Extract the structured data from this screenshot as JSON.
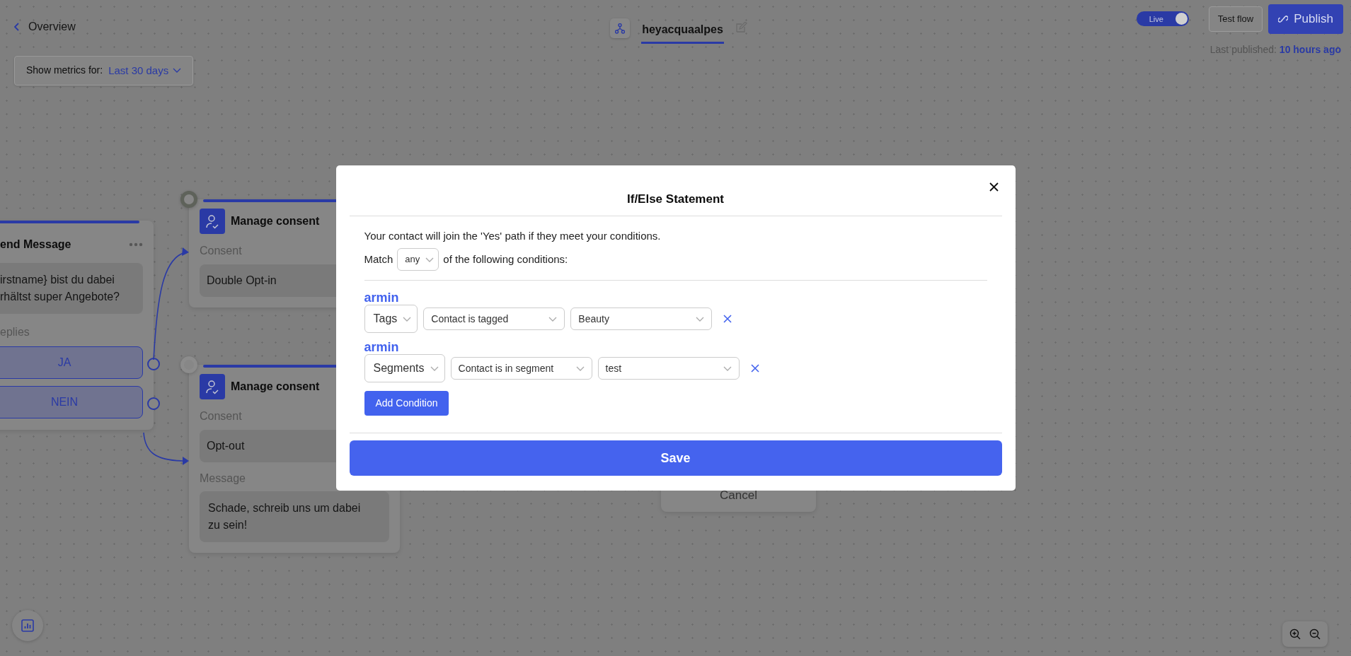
{
  "header": {
    "back": "Overview",
    "flow_name": "heyacquaalpes",
    "live": {
      "label": "Live",
      "on": true
    },
    "test_flow": "Test flow",
    "publish": "Publish",
    "last_published_label": "Last published:",
    "last_published_value": "10 hours ago"
  },
  "metrics_filter": {
    "label": "Show metrics for:",
    "value": "Last 30 days"
  },
  "canvas_nodes": [
    {
      "kind": "send_message",
      "title": "end Message",
      "message_lines": [
        "irstname} bist du dabei",
        "rhältst super Angebote?"
      ],
      "replies_label": "eplies",
      "replies": [
        "JA",
        "NEIN"
      ]
    },
    {
      "kind": "manage_consent",
      "title": "Manage consent",
      "consent_label": "Consent",
      "consent_value": "Double Opt-in"
    },
    {
      "kind": "manage_consent",
      "title": "Manage consent",
      "consent_label": "Consent",
      "consent_value": "Opt-out",
      "message_label": "Message",
      "message": "Schade, schreib uns um dabei zu sein!"
    },
    {
      "kind": "button_card",
      "label": "Cancel"
    }
  ],
  "modal": {
    "title": "If/Else Statement",
    "intro": "Your contact will join the 'Yes' path if they meet your conditions.",
    "match_prefix": "Match",
    "match_value": "any",
    "match_suffix": "of the following conditions:",
    "conditions": [
      {
        "name": "armin",
        "field": "Tags",
        "operator": "Contact is tagged",
        "value": "Beauty"
      },
      {
        "name": "armin",
        "field": "Segments",
        "operator": "Contact is in segment",
        "value": "test"
      }
    ],
    "add_condition": "Add Condition",
    "save": "Save"
  }
}
